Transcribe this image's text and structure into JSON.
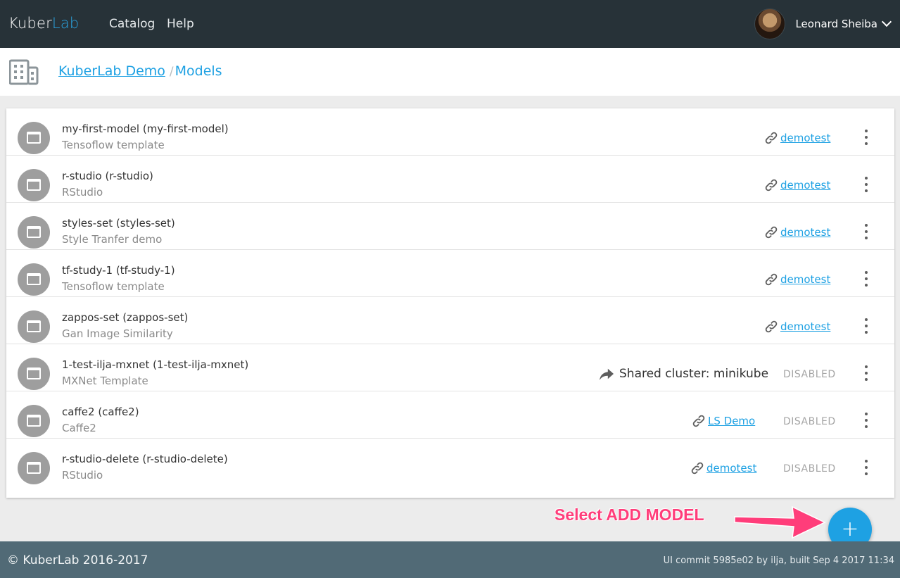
{
  "topbar": {
    "brand_main": "Kuber",
    "brand_accent": "Lab",
    "nav": [
      "Catalog",
      "Help"
    ],
    "user_name": "Leonard Sheiba",
    "user_menu_icon": "chevron-down-icon"
  },
  "breadcrumb": {
    "org_icon": "building-icon",
    "org": "KuberLab Demo",
    "separator": "/",
    "current": "Models"
  },
  "models": [
    {
      "title": "my-first-model (my-first-model)",
      "subtitle": "Tensoflow template",
      "cluster": "demotest",
      "cluster_kind": "link",
      "status": ""
    },
    {
      "title": "r-studio (r-studio)",
      "subtitle": "RStudio",
      "cluster": "demotest",
      "cluster_kind": "link",
      "status": ""
    },
    {
      "title": "styles-set (styles-set)",
      "subtitle": "Style Tranfer demo",
      "cluster": "demotest",
      "cluster_kind": "link",
      "status": ""
    },
    {
      "title": "tf-study-1 (tf-study-1)",
      "subtitle": "Tensoflow template",
      "cluster": "demotest",
      "cluster_kind": "link",
      "status": ""
    },
    {
      "title": "zappos-set (zappos-set)",
      "subtitle": "Gan Image Similarity",
      "cluster": "demotest",
      "cluster_kind": "link",
      "status": ""
    },
    {
      "title": "1-test-ilja-mxnet (1-test-ilja-mxnet)",
      "subtitle": "MXNet Template",
      "cluster": "Shared cluster: minikube",
      "cluster_kind": "shared",
      "status": "DISABLED"
    },
    {
      "title": "caffe2 (caffe2)",
      "subtitle": "Caffe2",
      "cluster": "LS Demo",
      "cluster_kind": "link",
      "status": "DISABLED"
    },
    {
      "title": "r-studio-delete (r-studio-delete)",
      "subtitle": "RStudio",
      "cluster": "demotest",
      "cluster_kind": "link",
      "status": "DISABLED"
    }
  ],
  "annotation": {
    "text": "Select ADD MODEL",
    "color": "#ff3d7a"
  },
  "fab": {
    "icon": "plus-icon",
    "glyph": "+"
  },
  "footer": {
    "copyright": "© KuberLab 2016-2017",
    "commit": "UI commit 5985e02 by ilja, built Sep 4 2017 11:34"
  },
  "colors": {
    "topbar": "#273238",
    "accent": "#1ea1e3",
    "footer": "#516a76"
  }
}
